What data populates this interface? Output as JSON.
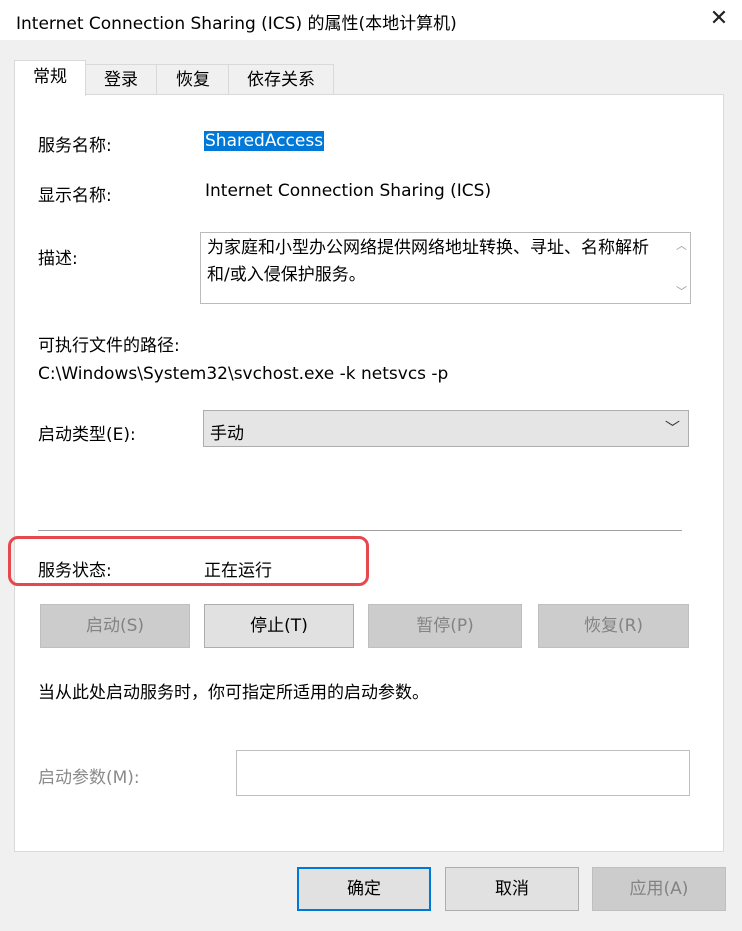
{
  "window": {
    "title": "Internet Connection Sharing (ICS) 的属性(本地计算机)",
    "close_glyph": "✕"
  },
  "tabs": [
    {
      "label": "常规"
    },
    {
      "label": "登录"
    },
    {
      "label": "恢复"
    },
    {
      "label": "依存关系"
    }
  ],
  "general": {
    "service_name_label": "服务名称:",
    "service_name": "SharedAccess",
    "display_name_label": "显示名称:",
    "display_name": "Internet Connection Sharing (ICS)",
    "description_label": "描述:",
    "description": "为家庭和小型办公网络提供网络地址转换、寻址、名称解析和/或入侵保护服务。",
    "path_label": "可执行文件的路径:",
    "path": "C:\\Windows\\System32\\svchost.exe -k netsvcs -p",
    "startup_type_label": "启动类型(E):",
    "startup_type": "手动",
    "status_label": "服务状态:",
    "status": "正在运行",
    "buttons": {
      "start": "启动(S)",
      "stop": "停止(T)",
      "pause": "暂停(P)",
      "resume": "恢复(R)"
    },
    "hint": "当从此处启动服务时，你可指定所适用的启动参数。",
    "params_label": "启动参数(M):",
    "params_value": ""
  },
  "footer": {
    "ok": "确定",
    "cancel": "取消",
    "apply": "应用(A)"
  }
}
